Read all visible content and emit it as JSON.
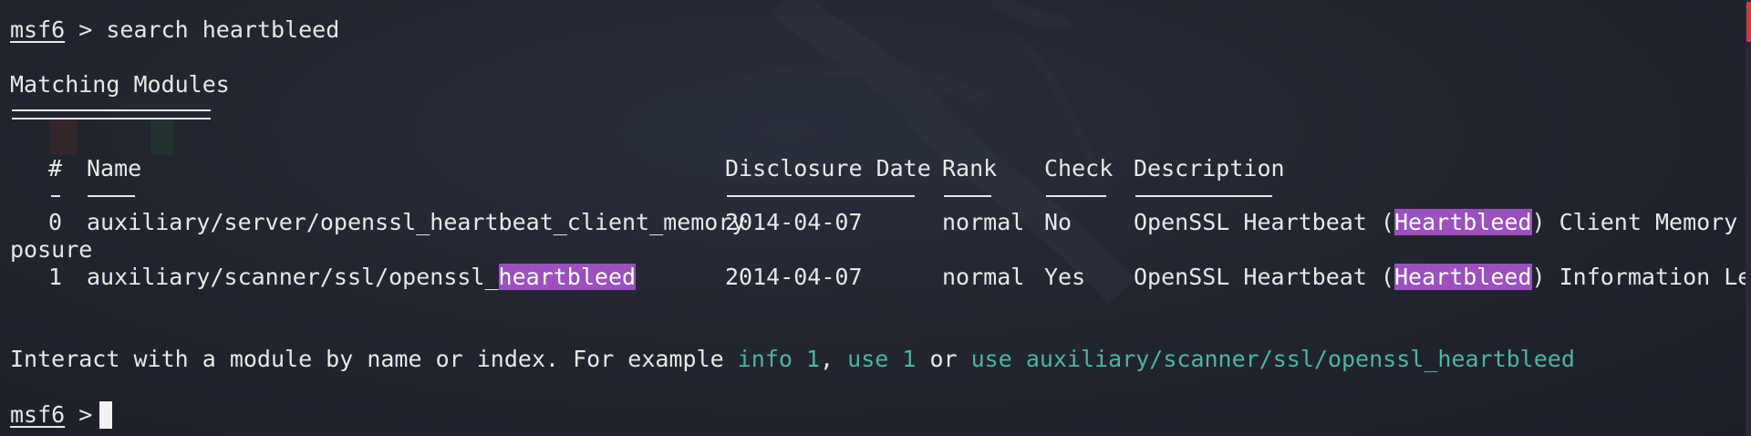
{
  "prompt": {
    "name": "msf6",
    "symbol": " > "
  },
  "command": "search heartbleed",
  "section_title": "Matching Modules",
  "table": {
    "headers": {
      "num": "#",
      "name": "Name",
      "date": "Disclosure Date",
      "rank": "Rank",
      "check": "Check",
      "description": "Description"
    },
    "rows": [
      {
        "num": "0",
        "name": "auxiliary/server/openssl_heartbeat_client_memory",
        "date": "2014-04-07",
        "rank": "normal",
        "check": "No",
        "desc_prefix": "OpenSSL Heartbeat (",
        "desc_highlight": "Heartbleed",
        "desc_suffix": ") Client Memory Ex",
        "desc_wrap": "posure"
      },
      {
        "num": "1",
        "name_prefix": "auxiliary/scanner/ssl/openssl_",
        "name_highlight": "heartbleed",
        "date": "2014-04-07",
        "rank": "normal",
        "check": "Yes",
        "desc_prefix": "OpenSSL Heartbeat (",
        "desc_highlight": "Heartbleed",
        "desc_suffix": ") Information Leak"
      }
    ]
  },
  "hint": {
    "text": "Interact with a module by name or index. For example ",
    "example1": "info 1",
    "sep1": ", ",
    "example2": "use 1",
    "sep2": " or ",
    "example3": "use auxiliary/scanner/ssl/openssl_heartbleed"
  },
  "colors": {
    "background": "#1f2330",
    "text": "#e8e8e8",
    "highlight": "#9c4fbf",
    "link": "#4fb3a6",
    "scroll_thumb": "#d33b3b"
  }
}
